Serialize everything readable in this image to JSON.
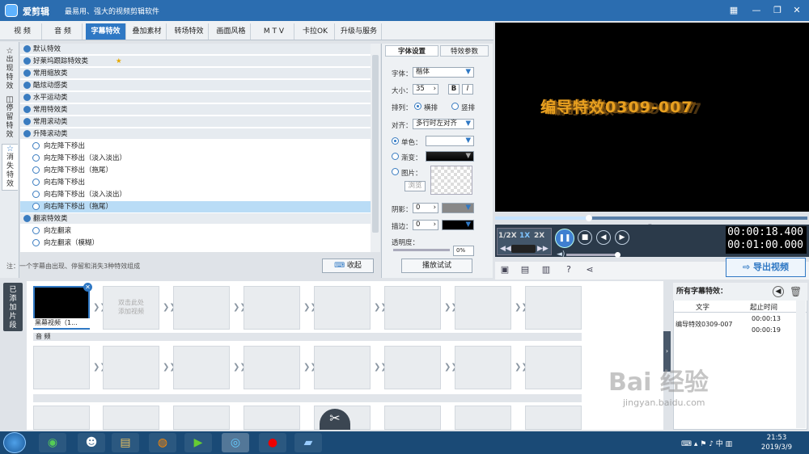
{
  "window": {
    "app_name": "爱剪辑",
    "slogan": "最易用、强大的视频剪辑软件"
  },
  "menu": [
    "视 频",
    "音 频",
    "字幕特效",
    "叠加素材",
    "转场特效",
    "画面风格",
    "M T V",
    "卡拉OK",
    "升级与服务"
  ],
  "side_tabs": [
    "出现特效",
    "停留特效",
    "消失特效"
  ],
  "effects": {
    "rows": [
      {
        "type": "cat",
        "label": "默认特效"
      },
      {
        "type": "cat",
        "label": "好莱坞跟踪特效类"
      },
      {
        "type": "cat",
        "label": "常用缩放类"
      },
      {
        "type": "cat",
        "label": "酷炫动感类"
      },
      {
        "type": "cat",
        "label": "水平运动类"
      },
      {
        "type": "cat",
        "label": "常用特效类"
      },
      {
        "type": "cat",
        "label": "常用滚动类"
      },
      {
        "type": "cat",
        "label": "升降滚动类"
      },
      {
        "type": "item",
        "label": "向左降下移出"
      },
      {
        "type": "item",
        "label": "向左降下移出（淡入淡出）"
      },
      {
        "type": "item",
        "label": "向左降下移出（拖尾）"
      },
      {
        "type": "item",
        "label": "向右降下移出"
      },
      {
        "type": "item",
        "label": "向右降下移出（淡入淡出）"
      },
      {
        "type": "sel",
        "label": "向右降下移出（拖尾）"
      },
      {
        "type": "cat",
        "label": "翻滚特效类"
      },
      {
        "type": "item",
        "label": "向左翻滚"
      },
      {
        "type": "item",
        "label": "向左翻滚（模糊）"
      }
    ],
    "note": "注：一个字幕由出现、停留和消失3种特效组成",
    "collapse_label": "收起"
  },
  "props": {
    "tab_font": "字体设置",
    "tab_effect": "特效参数",
    "font_label": "字体：",
    "font_value": "楷体",
    "size_label": "大小：",
    "size_value": "35",
    "bold": "B",
    "italic": "I",
    "layout_label": "排列：",
    "layout_h": "横排",
    "layout_v": "竖排",
    "align_label": "对齐：",
    "align_value": "多行时左对齐",
    "solid_label": "单色：",
    "gradient_label": "渐变：",
    "image_label": "图片：",
    "browse_label": "浏览",
    "shadow_label": "阴影：",
    "shadow_value": "0",
    "stroke_label": "描边：",
    "stroke_value": "0",
    "opacity_label": "透明度：",
    "opacity_value": "0%",
    "play_test_label": "播放试试"
  },
  "preview": {
    "text": "编导特效0309-007"
  },
  "player": {
    "speeds": [
      "1/2X",
      "1X",
      "2X"
    ],
    "current_speed": "1X",
    "time_current": "00:00:18.400",
    "time_total": "00:01:00.000",
    "progress": 0.3,
    "export_label": "导出视频"
  },
  "timeline": {
    "label": "已添加片段",
    "first_clip_label": "黑幕视频（1...",
    "placeholder": "双击此处\n添加视频",
    "audio_label": "音 频"
  },
  "right_panel": {
    "title": "所有字幕特效：",
    "col_text": "文字",
    "col_time": "起止时间",
    "entries": [
      {
        "text": "编导特效0309-007",
        "start": "00:00:13",
        "end": "00:00:19"
      }
    ]
  },
  "taskbar": {
    "time": "21:53",
    "date": "2019/3/9"
  },
  "watermark": {
    "main": "Bai 经验",
    "sub": "jingyan.baidu.com"
  }
}
